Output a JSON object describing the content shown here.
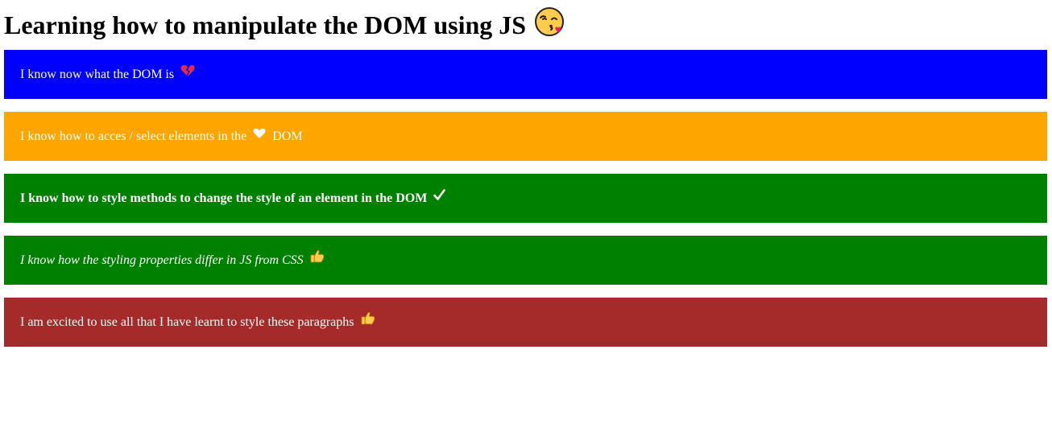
{
  "heading": {
    "title": "Learning how to manipulate the DOM using JS",
    "emoji_icon": "face-blowing-kiss-icon"
  },
  "paragraphs": [
    {
      "text": "I know now what the DOM is",
      "background": "#0000ff",
      "icon": "broken-heart-icon",
      "style": "normal"
    },
    {
      "text": "I know how to acces / select elements in the",
      "trailing_text": "DOM",
      "background": "#ffa500",
      "icon": "white-heart-icon",
      "style": "normal"
    },
    {
      "text": "I know how to style methods to change the style of an element in the DOM",
      "background": "#008000",
      "icon": "check-mark-icon",
      "style": "bold"
    },
    {
      "text": "I know how the styling properties differ in JS from CSS",
      "background": "#008000",
      "icon": "thumbs-up-icon",
      "style": "italic"
    },
    {
      "text": "I am excited to use all that I have learnt to style these paragraphs",
      "background": "#a52a2a",
      "icon": "thumbs-up-icon",
      "style": "normal"
    }
  ]
}
